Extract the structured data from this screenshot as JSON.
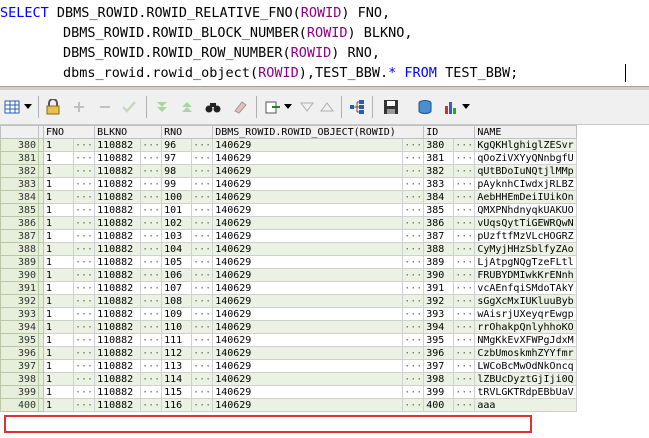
{
  "sql": {
    "line1": {
      "kw": "SELECT",
      "fn": "DBMS_ROWID.ROWID_RELATIVE_FNO",
      "arg": "ROWID",
      "rest": " FNO,"
    },
    "line2": {
      "fn": "DBMS_ROWID.ROWID_BLOCK_NUMBER",
      "arg": "ROWID",
      "rest": " BLKNO,"
    },
    "line3": {
      "fn": "DBMS_ROWID.ROWID_ROW_NUMBER",
      "arg": "ROWID",
      "rest": " RNO,"
    },
    "line4": {
      "fn": "dbms_rowid.rowid_object",
      "arg": "ROWID",
      "rest1": ",TEST_BBW.",
      "star": "*",
      "from": "FROM",
      "rest2": "TEST_BBW;"
    }
  },
  "toolbar": {
    "icons": [
      "grid-icon",
      "lock-icon",
      "add-icon",
      "remove-icon",
      "check-icon",
      "filter-down-icon",
      "filter-up-icon",
      "binoculars-icon",
      "eraser-icon",
      "export-icon",
      "triangle-down-icon",
      "triangle-up-icon",
      "tree-icon",
      "save-icon",
      "database-icon",
      "chart-icon"
    ]
  },
  "grid": {
    "columns": [
      "FNO",
      "BLKNO",
      "RNO",
      "DBMS_ROWID.ROWID_OBJECT(ROWID)",
      "ID",
      "NAME"
    ],
    "rows": [
      {
        "n": "380",
        "fno": "1",
        "blk": "110882",
        "rno": "96",
        "obj": "140629",
        "id": "380",
        "name": "KgQKHlghiglZESvr"
      },
      {
        "n": "381",
        "fno": "1",
        "blk": "110882",
        "rno": "97",
        "obj": "140629",
        "id": "381",
        "name": "qOoZiVXYyQNnbgfU"
      },
      {
        "n": "382",
        "fno": "1",
        "blk": "110882",
        "rno": "98",
        "obj": "140629",
        "id": "382",
        "name": "qUtBDoIuNQtjlMMp"
      },
      {
        "n": "383",
        "fno": "1",
        "blk": "110882",
        "rno": "99",
        "obj": "140629",
        "id": "383",
        "name": "pAyknhCIwdxjRLBZ"
      },
      {
        "n": "384",
        "fno": "1",
        "blk": "110882",
        "rno": "100",
        "obj": "140629",
        "id": "384",
        "name": "AebHHEmDeiIUikOn"
      },
      {
        "n": "385",
        "fno": "1",
        "blk": "110882",
        "rno": "101",
        "obj": "140629",
        "id": "385",
        "name": "QMXPNhdnyqkUAKUO"
      },
      {
        "n": "386",
        "fno": "1",
        "blk": "110882",
        "rno": "102",
        "obj": "140629",
        "id": "386",
        "name": "vUqsQytTiGEWRQwN"
      },
      {
        "n": "387",
        "fno": "1",
        "blk": "110882",
        "rno": "103",
        "obj": "140629",
        "id": "387",
        "name": "pUzftfMzVLcHOGRZ"
      },
      {
        "n": "388",
        "fno": "1",
        "blk": "110882",
        "rno": "104",
        "obj": "140629",
        "id": "388",
        "name": "CyMyjHHzSblfyZAo"
      },
      {
        "n": "389",
        "fno": "1",
        "blk": "110882",
        "rno": "105",
        "obj": "140629",
        "id": "389",
        "name": "LjAtpgNQgTzeFLtl"
      },
      {
        "n": "390",
        "fno": "1",
        "blk": "110882",
        "rno": "106",
        "obj": "140629",
        "id": "390",
        "name": "FRUBYDMIwkKrENnh"
      },
      {
        "n": "391",
        "fno": "1",
        "blk": "110882",
        "rno": "107",
        "obj": "140629",
        "id": "391",
        "name": "vcAEnfqiSMdoTAkY"
      },
      {
        "n": "392",
        "fno": "1",
        "blk": "110882",
        "rno": "108",
        "obj": "140629",
        "id": "392",
        "name": "sGgXcMxIUKluuByb"
      },
      {
        "n": "393",
        "fno": "1",
        "blk": "110882",
        "rno": "109",
        "obj": "140629",
        "id": "393",
        "name": "wAisrjUXeyqrEwgp"
      },
      {
        "n": "394",
        "fno": "1",
        "blk": "110882",
        "rno": "110",
        "obj": "140629",
        "id": "394",
        "name": "rrOhakpQnlyhhoKO"
      },
      {
        "n": "395",
        "fno": "1",
        "blk": "110882",
        "rno": "111",
        "obj": "140629",
        "id": "395",
        "name": "NMgKkEvXFWPgJdxM"
      },
      {
        "n": "396",
        "fno": "1",
        "blk": "110882",
        "rno": "112",
        "obj": "140629",
        "id": "396",
        "name": "CzbUmoskmhZYYfmr"
      },
      {
        "n": "397",
        "fno": "1",
        "blk": "110882",
        "rno": "113",
        "obj": "140629",
        "id": "397",
        "name": "LWCoBcMwOdNkOncq"
      },
      {
        "n": "398",
        "fno": "1",
        "blk": "110882",
        "rno": "114",
        "obj": "140629",
        "id": "398",
        "name": "lZBUcDyztGjIji0Q"
      },
      {
        "n": "399",
        "fno": "1",
        "blk": "110882",
        "rno": "115",
        "obj": "140629",
        "id": "399",
        "name": "tRVLGKTRdpEBbUaV"
      },
      {
        "n": "400",
        "fno": "1",
        "blk": "110882",
        "rno": "116",
        "obj": "140629",
        "id": "400",
        "name": "aaa"
      }
    ],
    "dots": "···"
  }
}
